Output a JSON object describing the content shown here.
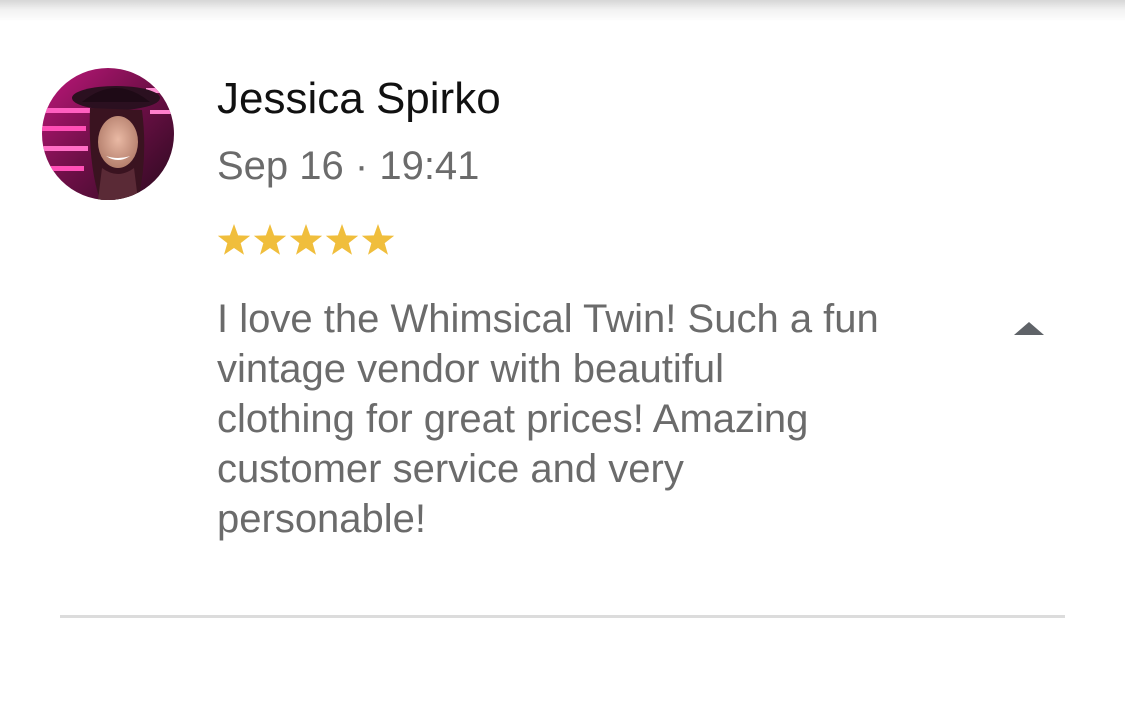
{
  "review": {
    "reviewer_name": "Jessica Spirko",
    "date": "Sep 16 · 19:41",
    "rating": 5,
    "rating_max": 5,
    "text": "I love the Whimsical Twin! Such a fun\nvintage vendor with beautiful\nclothing for great prices! Amazing\ncustomer service and very\npersonable!",
    "collapse_icon": "caret-up-icon",
    "avatar_icon": "reviewer-avatar"
  },
  "colors": {
    "star": "#F0BE3C",
    "name_text": "#111111",
    "secondary_text": "#6B6B6B",
    "divider": "#DCDCDC",
    "caret": "#5F6368"
  }
}
